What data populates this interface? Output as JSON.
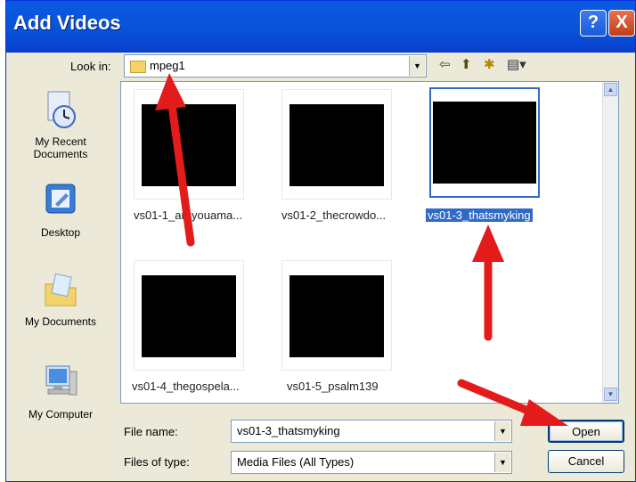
{
  "window": {
    "title": "Add Videos",
    "help_icon": "?",
    "close_icon": "X"
  },
  "toolbar": {
    "look_in_label": "Look in:",
    "look_in_value": "mpeg1",
    "icons": [
      "back-icon",
      "up-folder-icon",
      "new-folder-icon",
      "views-menu-icon"
    ]
  },
  "places": [
    {
      "label": "My Recent Documents",
      "icon": "recent-documents-icon"
    },
    {
      "label": "Desktop",
      "icon": "desktop-icon"
    },
    {
      "label": "My Documents",
      "icon": "my-documents-icon"
    },
    {
      "label": "My Computer",
      "icon": "my-computer-icon"
    }
  ],
  "files": [
    {
      "name": "vs01-1_areyouama...",
      "selected": false
    },
    {
      "name": "vs01-2_thecrowdo...",
      "selected": false
    },
    {
      "name": "vs01-3_thatsmyking",
      "selected": true
    },
    {
      "name": "vs01-4_thegospela...",
      "selected": false
    },
    {
      "name": "vs01-5_psalm139",
      "selected": false
    }
  ],
  "form": {
    "file_name_label": "File name:",
    "file_name_value": "vs01-3_thatsmyking",
    "files_of_type_label": "Files of type:",
    "files_of_type_value": "Media Files (All Types)"
  },
  "buttons": {
    "open": "Open",
    "cancel": "Cancel"
  },
  "colors": {
    "titlebar": "#0a5be0",
    "selection": "#316ac5",
    "annotation_arrow": "#e31b1b"
  }
}
